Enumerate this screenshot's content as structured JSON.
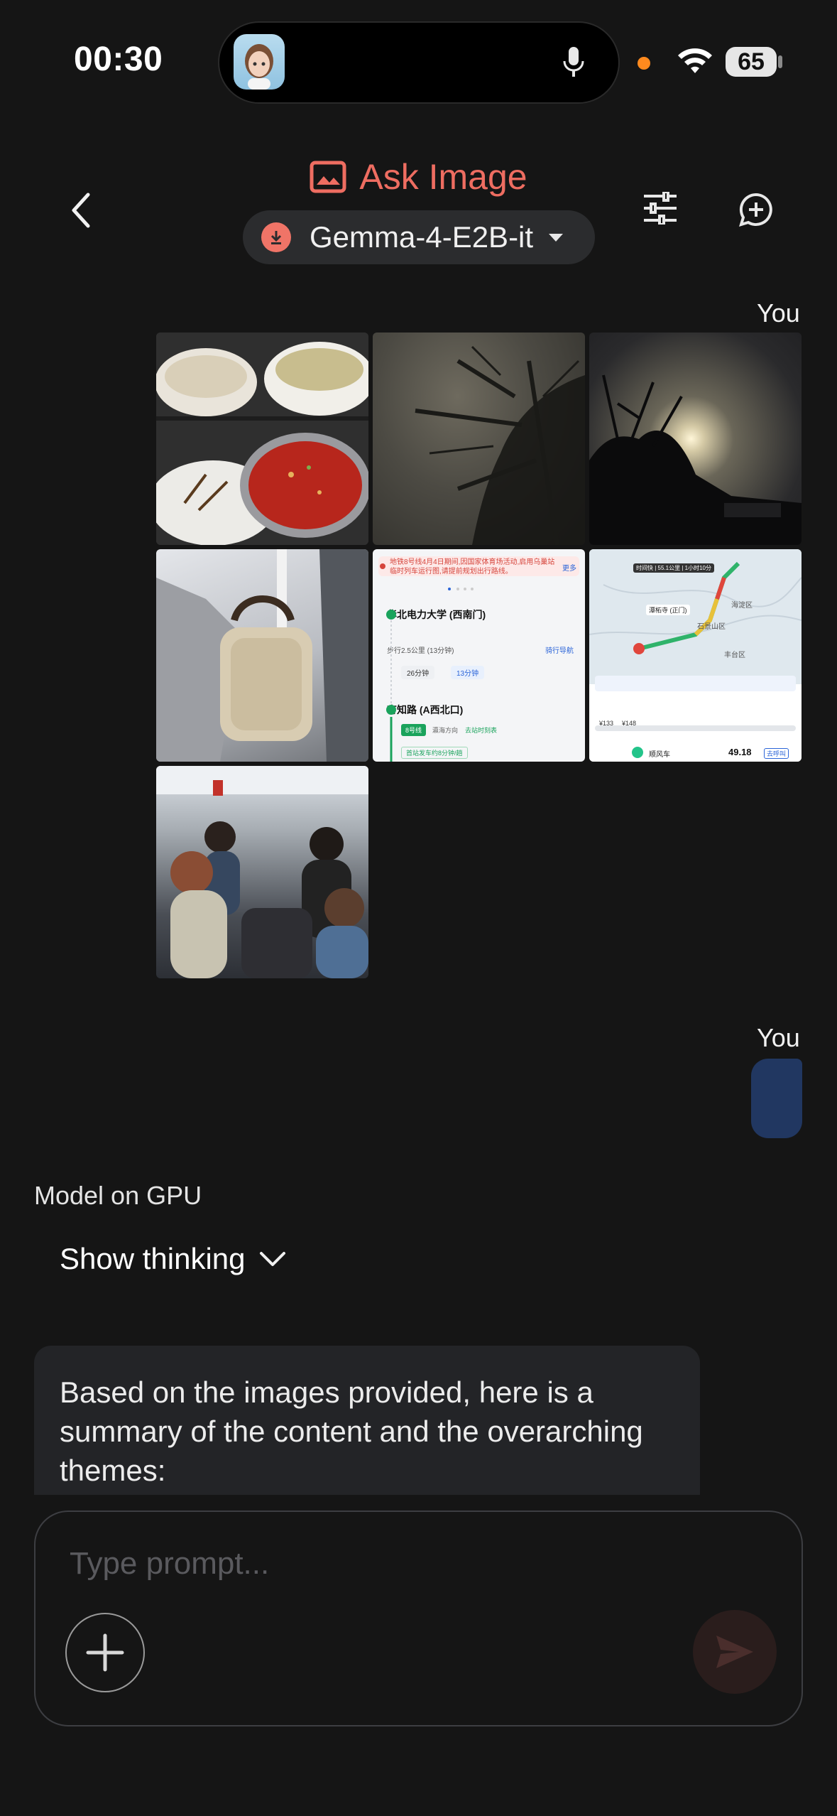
{
  "status_bar": {
    "time": "00:30",
    "battery": "65"
  },
  "header": {
    "title": "Ask Image",
    "model_name": "Gemma-4-E2B-it",
    "accent": "#ee6d61"
  },
  "conversation": {
    "you_label_1": "You",
    "images": [
      {
        "name": "food-photo"
      },
      {
        "name": "tree-night-photo"
      },
      {
        "name": "moon-night-photo"
      },
      {
        "name": "subway-bag-photo"
      },
      {
        "name": "route-screenshot",
        "stop_1": "华北电力大学 (西南门)",
        "stop_2": "育知路 (A西北口)",
        "walk": "步行2.5公里 (13分钟)",
        "alert": "地铁8号线4月4日期间,因国家体育场活动,启用乌巢站临时列车运行图,请提前规划出行路线。",
        "more": "更多",
        "chip_1": "26分钟",
        "chip_2": "13分钟",
        "bike": "骑行导航",
        "line": "8号线",
        "direction": "瀛海方向",
        "timetable": "去站时刻表",
        "next_train": "首站发车约8分钟/趟"
      },
      {
        "name": "map-screenshot",
        "price": "49.18",
        "label_1": "海淀区",
        "label_2": "石景山区",
        "label_3": "丰台区",
        "dest": "潭柘寺 (正门)",
        "eta": "时间快 | 55.1公里 | 1小时10分",
        "tag_1": "¥133",
        "tag_2": "¥148",
        "car": "顺风车",
        "call": "去呼叫"
      },
      {
        "name": "subway-crowd-photo"
      }
    ],
    "you_label_2": "You",
    "model_on": "Model on GPU",
    "show_thinking": "Show thinking",
    "answer_text": "Based on the images provided, here is a summary of the content and the overarching themes:"
  },
  "composer": {
    "placeholder": "Type prompt..."
  },
  "colors": {
    "bubble_blue": "#213761",
    "send_disabled": "#2a1d1c"
  }
}
